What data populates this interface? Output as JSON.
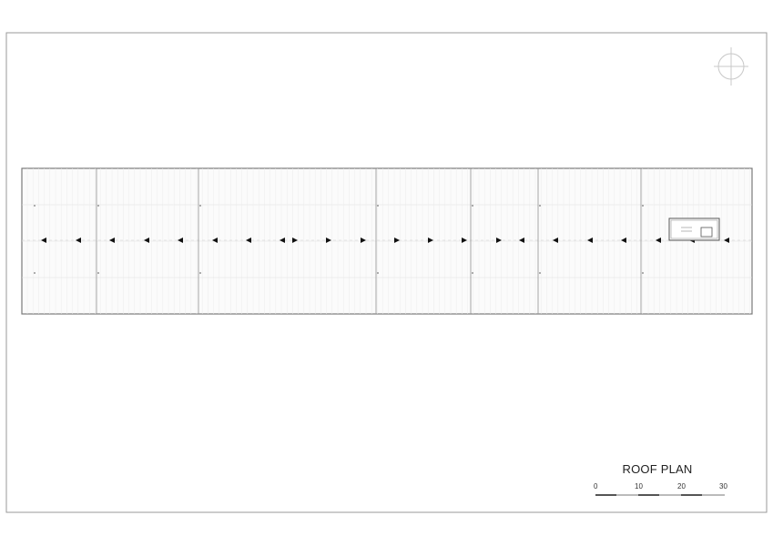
{
  "drawing": {
    "title": "ROOF PLAN",
    "north_arrow": "north-arrow-icon",
    "scale_bar": {
      "labels": [
        "0",
        "10",
        "20",
        "30"
      ]
    },
    "roof": {
      "bays": 7,
      "flow_arrows": [
        "left",
        "left",
        "left",
        "left",
        "left",
        "left",
        "right",
        "right",
        "right",
        "right",
        "right",
        "left",
        "left",
        "left",
        "left",
        "left",
        "left"
      ]
    }
  }
}
